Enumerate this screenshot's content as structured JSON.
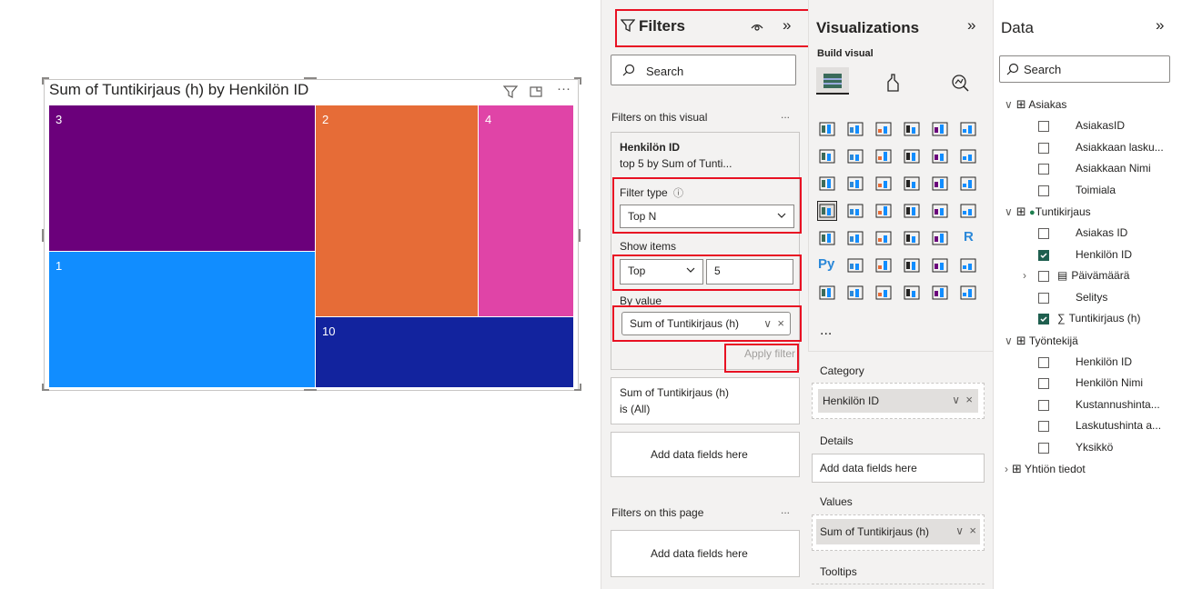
{
  "visual": {
    "title": "Sum of Tuntikirjaus (h) by Henkilön ID",
    "tiles": [
      {
        "label": "3",
        "color": "#6b007b"
      },
      {
        "label": "2",
        "color": "#e66c37"
      },
      {
        "label": "4",
        "color": "#e044a7"
      },
      {
        "label": "1",
        "color": "#118dff"
      },
      {
        "label": "10",
        "color": "#12239e"
      }
    ]
  },
  "filters": {
    "title": "Filters",
    "search_placeholder": "Search",
    "section_visual": "Filters on this visual",
    "card": {
      "field": "Henkilön ID",
      "summary": "top 5 by Sum of Tunti...",
      "filter_type_label": "Filter type",
      "filter_type_value": "Top N",
      "show_items_label": "Show items",
      "show_items_direction": "Top",
      "show_items_count": "5",
      "by_value_label": "By value",
      "by_value_field": "Sum of Tuntikirjaus (h)",
      "apply_label": "Apply filter"
    },
    "card2": {
      "line1": "Sum of Tuntikirjaus (h)",
      "line2": "is (All)"
    },
    "add_fields_visual": "Add data fields here",
    "section_page": "Filters on this page",
    "add_fields_page": "Add data fields here",
    "more": "..."
  },
  "viz": {
    "title": "Visualizations",
    "build_visual": "Build visual",
    "more": "...",
    "category_label": "Category",
    "category_value": "Henkilön ID",
    "details_label": "Details",
    "details_value": "Add data fields here",
    "values_label": "Values",
    "values_value": "Sum of Tuntikirjaus (h)",
    "tooltips_label": "Tooltips",
    "r_label": "R",
    "py_label": "Py"
  },
  "data": {
    "title": "Data",
    "search_placeholder": "Search",
    "tables": {
      "asiakas": "Asiakas",
      "asiakas_fields": [
        "AsiakasID",
        "Asiakkaan lasku...",
        "Asiakkaan Nimi",
        "Toimiala"
      ],
      "tuntikirjaus": "Tuntikirjaus",
      "tuntikirjaus_fields": [
        "Asiakas ID",
        "Henkilön ID",
        "Päivämäärä",
        "Selitys",
        "Tuntikirjaus (h)"
      ],
      "tyontekija": "Työntekijä",
      "tyontekija_fields": [
        "Henkilön ID",
        "Henkilön Nimi",
        "Kustannushinta...",
        "Laskutushinta a...",
        "Yksikkö"
      ],
      "yhtion": "Yhtiön tiedot"
    }
  }
}
